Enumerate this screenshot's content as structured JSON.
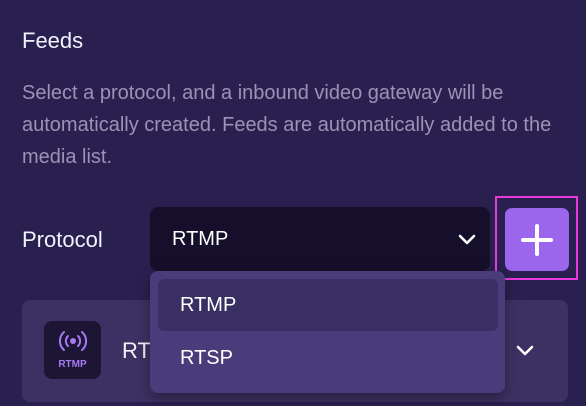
{
  "feeds": {
    "title": "Feeds",
    "description": "Select a protocol, and a inbound video gateway will be automatically created. Feeds are automatically added to the media list."
  },
  "protocol": {
    "label": "Protocol",
    "selected": "RTMP",
    "options": [
      "RTMP",
      "RTSP"
    ],
    "add_button_icon": "plus-icon",
    "highlight_color": "#e83ad8",
    "accent_color": "#9b65ec"
  },
  "feed_item": {
    "icon": "broadcast-icon",
    "icon_label": "RTMP",
    "name": "RTMP"
  }
}
